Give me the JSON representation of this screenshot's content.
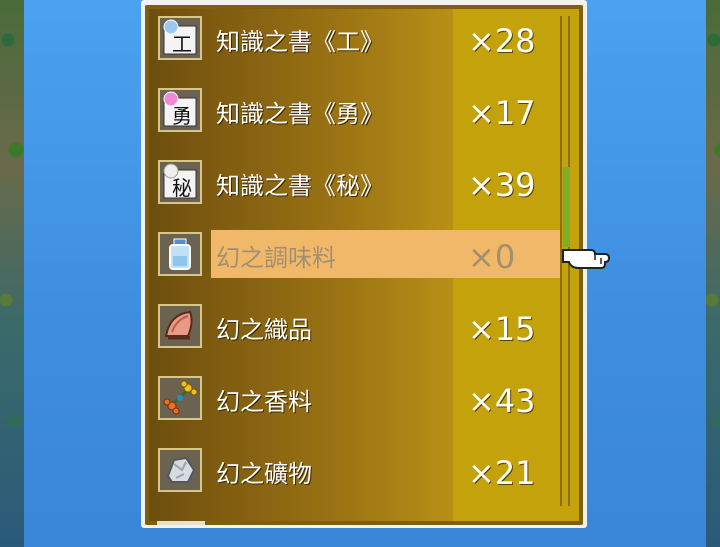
{
  "items": [
    {
      "name": "知識之書《工》",
      "qty": "×28",
      "glyph": "工",
      "orb": "#9cc8f0",
      "icon": "book-work-icon"
    },
    {
      "name": "知識之書《勇》",
      "qty": "×17",
      "glyph": "勇",
      "orb": "#f08ad8",
      "icon": "book-courage-icon"
    },
    {
      "name": "知識之書《秘》",
      "qty": "×39",
      "glyph": "秘",
      "orb": "#eeeeee",
      "icon": "book-secret-icon"
    },
    {
      "name": "幻之調味料",
      "qty": "×0",
      "glyph": "",
      "orb": "",
      "icon": "seasoning-bottle-icon"
    },
    {
      "name": "幻之織品",
      "qty": "×15",
      "glyph": "",
      "orb": "",
      "icon": "fabric-icon"
    },
    {
      "name": "幻之香料",
      "qty": "×43",
      "glyph": "",
      "orb": "",
      "icon": "spice-flower-icon"
    },
    {
      "name": "幻之礦物",
      "qty": "×21",
      "glyph": "",
      "orb": "",
      "icon": "ore-icon"
    }
  ],
  "selected_index": 3,
  "colors": {
    "panel_border": "#f2f2ee",
    "list_bg": "#9c7414",
    "qty_column": "#c4a20c",
    "highlight": "#f2b86a",
    "scroll_thumb": "#7ab02a"
  }
}
